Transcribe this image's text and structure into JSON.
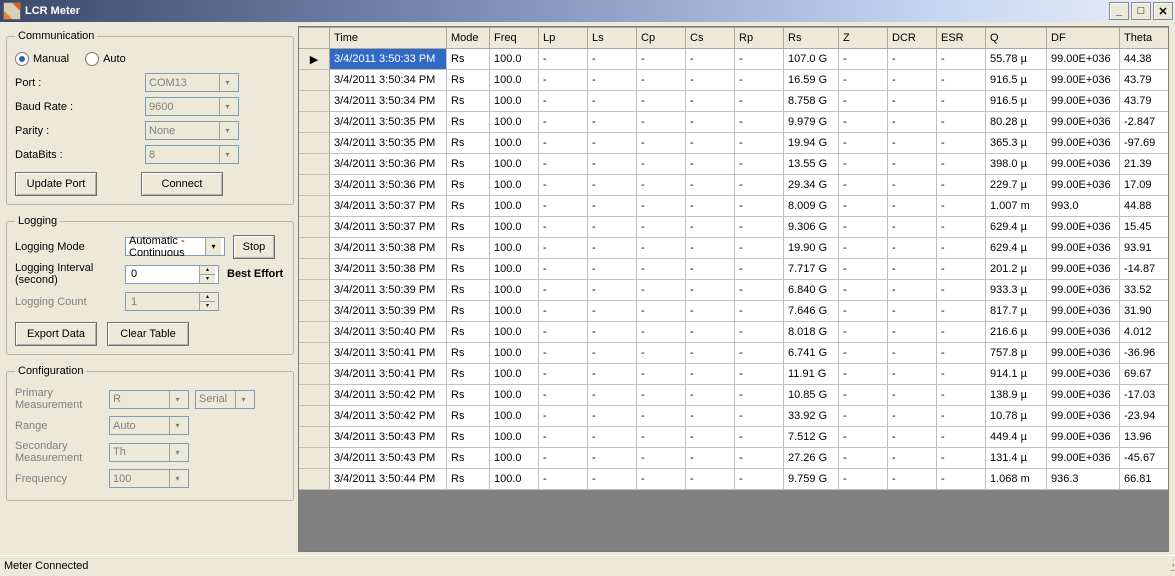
{
  "window": {
    "title": "LCR Meter"
  },
  "communication": {
    "legend": "Communication",
    "radio_manual": "Manual",
    "radio_auto": "Auto",
    "mode_selected": "manual",
    "port_label": "Port :",
    "port_value": "COM13",
    "baud_label": "Baud Rate :",
    "baud_value": "9600",
    "parity_label": "Parity :",
    "parity_value": "None",
    "databits_label": "DataBits :",
    "databits_value": "8",
    "update_btn": "Update Port",
    "connect_btn": "Connect"
  },
  "logging": {
    "legend": "Logging",
    "mode_label": "Logging Mode",
    "mode_value": "Automatic - Continuous",
    "stop_btn": "Stop",
    "interval_label": "Logging Interval (second)",
    "interval_value": "0",
    "best_effort": "Best Effort",
    "count_label": "Logging Count",
    "count_value": "1",
    "export_btn": "Export Data",
    "clear_btn": "Clear Table"
  },
  "configuration": {
    "legend": "Configuration",
    "primary_label": "Primary Measurement",
    "primary_value": "R",
    "serial_value": "Serial",
    "range_label": "Range",
    "range_value": "Auto",
    "secondary_label": "Secondary Measurement",
    "secondary_value": "Th",
    "freq_label": "Frequency",
    "freq_value": "100"
  },
  "grid": {
    "columns": [
      "Time",
      "Mode",
      "Freq",
      "Lp",
      "Ls",
      "Cp",
      "Cs",
      "Rp",
      "Rs",
      "Z",
      "DCR",
      "ESR",
      "Q",
      "DF",
      "Theta"
    ],
    "rows": [
      {
        "time": "3/4/2011 3:50:33 PM",
        "mode": "Rs",
        "freq": "100.0",
        "rs": "107.0 G",
        "q": "55.78 µ",
        "df": "99.00E+036",
        "theta": "44.38"
      },
      {
        "time": "3/4/2011 3:50:34 PM",
        "mode": "Rs",
        "freq": "100.0",
        "rs": "16.59 G",
        "q": "916.5 µ",
        "df": "99.00E+036",
        "theta": "43.79"
      },
      {
        "time": "3/4/2011 3:50:34 PM",
        "mode": "Rs",
        "freq": "100.0",
        "rs": "8.758 G",
        "q": "916.5 µ",
        "df": "99.00E+036",
        "theta": "43.79"
      },
      {
        "time": "3/4/2011 3:50:35 PM",
        "mode": "Rs",
        "freq": "100.0",
        "rs": "9.979 G",
        "q": "80.28 µ",
        "df": "99.00E+036",
        "theta": "-2.847"
      },
      {
        "time": "3/4/2011 3:50:35 PM",
        "mode": "Rs",
        "freq": "100.0",
        "rs": "19.94 G",
        "q": "365.3 µ",
        "df": "99.00E+036",
        "theta": "-97.69"
      },
      {
        "time": "3/4/2011 3:50:36 PM",
        "mode": "Rs",
        "freq": "100.0",
        "rs": "13.55 G",
        "q": "398.0 µ",
        "df": "99.00E+036",
        "theta": "21.39"
      },
      {
        "time": "3/4/2011 3:50:36 PM",
        "mode": "Rs",
        "freq": "100.0",
        "rs": "29.34 G",
        "q": "229.7 µ",
        "df": "99.00E+036",
        "theta": "17.09"
      },
      {
        "time": "3/4/2011 3:50:37 PM",
        "mode": "Rs",
        "freq": "100.0",
        "rs": "8.009 G",
        "q": "1.007 m",
        "df": "993.0",
        "theta": "44.88"
      },
      {
        "time": "3/4/2011 3:50:37 PM",
        "mode": "Rs",
        "freq": "100.0",
        "rs": "9.306 G",
        "q": "629.4 µ",
        "df": "99.00E+036",
        "theta": "15.45"
      },
      {
        "time": "3/4/2011 3:50:38 PM",
        "mode": "Rs",
        "freq": "100.0",
        "rs": "19.90 G",
        "q": "629.4 µ",
        "df": "99.00E+036",
        "theta": "93.91"
      },
      {
        "time": "3/4/2011 3:50:38 PM",
        "mode": "Rs",
        "freq": "100.0",
        "rs": "7.717 G",
        "q": "201.2 µ",
        "df": "99.00E+036",
        "theta": "-14.87"
      },
      {
        "time": "3/4/2011 3:50:39 PM",
        "mode": "Rs",
        "freq": "100.0",
        "rs": "6.840 G",
        "q": "933.3 µ",
        "df": "99.00E+036",
        "theta": "33.52"
      },
      {
        "time": "3/4/2011 3:50:39 PM",
        "mode": "Rs",
        "freq": "100.0",
        "rs": "7.646 G",
        "q": "817.7 µ",
        "df": "99.00E+036",
        "theta": "31.90"
      },
      {
        "time": "3/4/2011 3:50:40 PM",
        "mode": "Rs",
        "freq": "100.0",
        "rs": "8.018 G",
        "q": "216.6 µ",
        "df": "99.00E+036",
        "theta": "4.012"
      },
      {
        "time": "3/4/2011 3:50:41 PM",
        "mode": "Rs",
        "freq": "100.0",
        "rs": "6.741 G",
        "q": "757.8 µ",
        "df": "99.00E+036",
        "theta": "-36.96"
      },
      {
        "time": "3/4/2011 3:50:41 PM",
        "mode": "Rs",
        "freq": "100.0",
        "rs": "11.91 G",
        "q": "914.1 µ",
        "df": "99.00E+036",
        "theta": "69.67"
      },
      {
        "time": "3/4/2011 3:50:42 PM",
        "mode": "Rs",
        "freq": "100.0",
        "rs": "10.85 G",
        "q": "138.9 µ",
        "df": "99.00E+036",
        "theta": "-17.03"
      },
      {
        "time": "3/4/2011 3:50:42 PM",
        "mode": "Rs",
        "freq": "100.0",
        "rs": "33.92 G",
        "q": "10.78 µ",
        "df": "99.00E+036",
        "theta": "-23.94"
      },
      {
        "time": "3/4/2011 3:50:43 PM",
        "mode": "Rs",
        "freq": "100.0",
        "rs": "7.512 G",
        "q": "449.4 µ",
        "df": "99.00E+036",
        "theta": "13.96"
      },
      {
        "time": "3/4/2011 3:50:43 PM",
        "mode": "Rs",
        "freq": "100.0",
        "rs": "27.26 G",
        "q": "131.4 µ",
        "df": "99.00E+036",
        "theta": "-45.67"
      },
      {
        "time": "3/4/2011 3:50:44 PM",
        "mode": "Rs",
        "freq": "100.0",
        "rs": "9.759 G",
        "q": "1.068 m",
        "df": "936.3",
        "theta": "66.81"
      }
    ]
  },
  "status": {
    "text": "Meter Connected"
  },
  "glyphs": {
    "down": "▾",
    "up": "▴",
    "min": "_",
    "max": "□",
    "close": "✕",
    "arrow": "▶"
  }
}
